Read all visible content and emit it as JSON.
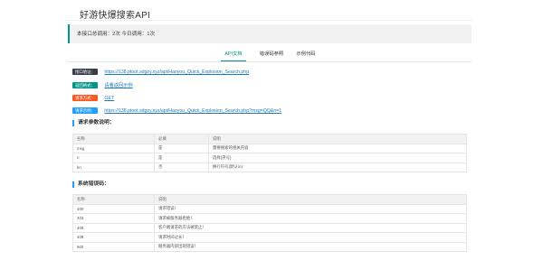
{
  "header": {
    "title": "好游快爆搜索API"
  },
  "stats": {
    "text": "本接口总调用：2次 今日调用：1次"
  },
  "tabs": [
    {
      "label": "API文档",
      "active": true
    },
    {
      "label": "错误码参照",
      "active": false
    },
    {
      "label": "示例代码",
      "active": false
    }
  ],
  "info": [
    {
      "badge": "接口地址：",
      "color": "#393d49",
      "value": "https://138.ptoot.sdgzy.xyz/api/Haoyou_Quick_Explosion_Search.php"
    },
    {
      "badge": "返回格式：",
      "color": "#009688",
      "value": "请看返回示例"
    },
    {
      "badge": "请求方式：",
      "color": "#ff5722",
      "value": "GET"
    },
    {
      "badge": "请求示例：",
      "color": "#1e9fff",
      "value": "https://138.ptoot.sdgzy.xyz/api/Haoyou_Quick_Explosion_Search.php?msg=QQ&n=1"
    }
  ],
  "params_section": {
    "heading": "请求参数说明：",
    "headers": [
      "名称",
      "必填",
      "说明"
    ],
    "rows": [
      [
        "msg",
        "是",
        "需要搜索的相关内容"
      ],
      [
        "n",
        "是",
        "选择(序号)"
      ],
      [
        "lm",
        "否",
        "换行符号(默认\\n)"
      ]
    ]
  },
  "errors_section": {
    "heading": "系统错误码：",
    "headers": [
      "名称",
      "说明"
    ],
    "rows": [
      [
        "400",
        "请求错误！"
      ],
      [
        "403",
        "请求被服务器拒绝！"
      ],
      [
        "405",
        "客户端请求的方法被禁止！"
      ],
      [
        "408",
        "请求时间过长！"
      ],
      [
        "500",
        "服务器内部出现错误！"
      ]
    ]
  }
}
